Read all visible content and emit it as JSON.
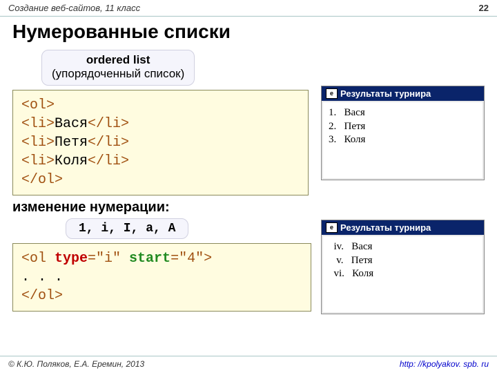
{
  "header": {
    "course": "Создание веб-сайтов, 11 класс",
    "page": "22"
  },
  "title": "Нумерованные списки",
  "callout1": {
    "bold": "ordered list",
    "plain": "(упорядоченный список)"
  },
  "code1": {
    "l1a": "<ol",
    "l1b": ">",
    "l2a": "<li>",
    "l2b": "Вася",
    "l2c": "</li>",
    "l3a": "<li>",
    "l3b": "Петя",
    "l3c": "</li>",
    "l4a": "<li>",
    "l4b": "Коля",
    "l4c": "</li>",
    "l5a": "</ol",
    "l5b": ">"
  },
  "preview1": {
    "title": "Результаты турнира",
    "lines": [
      "1.   Вася",
      "2.   Петя",
      "3.   Коля"
    ]
  },
  "subhead": "изменение нумерации:",
  "callout2": "1, i, I, a, A",
  "code2": {
    "p1": "<ol ",
    "kw1": "type",
    "p2": "=\"i\" ",
    "kw2": "start",
    "p3": "=\"4\">",
    "mid": ". . .",
    "end": "</ol>"
  },
  "preview2": {
    "title": "Результаты турнира",
    "lines": [
      "  iv.   Вася",
      "   v.   Петя",
      "  vi.   Коля"
    ]
  },
  "footer": {
    "copy": "© К.Ю. Поляков, Е.А. Еремин, 2013",
    "link": "http: //kpolyakov. spb. ru"
  }
}
